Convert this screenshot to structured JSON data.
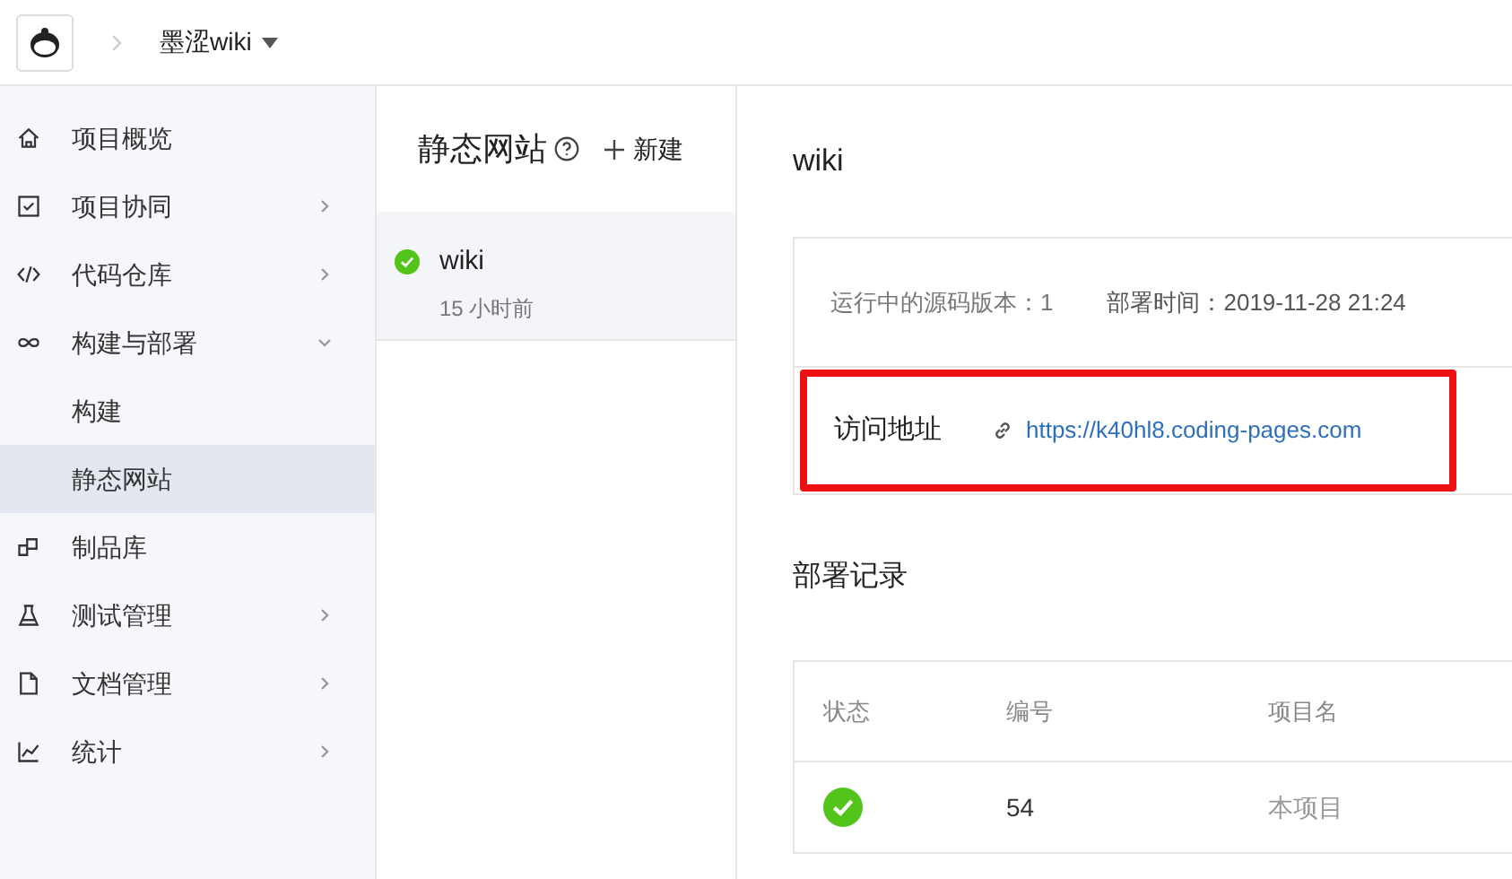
{
  "header": {
    "project": "墨涩wiki"
  },
  "sidebar": {
    "items": [
      {
        "label": "项目概览",
        "has_children": false,
        "selected": false
      },
      {
        "label": "项目协同",
        "has_children": true,
        "expanded": false,
        "selected": false
      },
      {
        "label": "代码仓库",
        "has_children": true,
        "expanded": false,
        "selected": false
      },
      {
        "label": "构建与部署",
        "has_children": true,
        "expanded": true,
        "selected": false,
        "children": [
          {
            "label": "构建",
            "selected": false
          },
          {
            "label": "静态网站",
            "selected": true
          }
        ]
      },
      {
        "label": "制品库",
        "has_children": false,
        "selected": false
      },
      {
        "label": "测试管理",
        "has_children": true,
        "expanded": false,
        "selected": false
      },
      {
        "label": "文档管理",
        "has_children": true,
        "expanded": false,
        "selected": false
      },
      {
        "label": "统计",
        "has_children": true,
        "expanded": false,
        "selected": false
      }
    ]
  },
  "site_list": {
    "title": "静态网站",
    "new_label": "新建",
    "items": [
      {
        "name": "wiki",
        "time": "15 小时前",
        "selected": true
      }
    ]
  },
  "detail": {
    "title": "wiki",
    "version": "运行中的源码版本：1",
    "deploy_time": "部署时间：2019-11-28 21:24",
    "url_label": "访问地址",
    "url": "https://k40hl8.coding-pages.com",
    "highlighted": true
  },
  "records": {
    "title": "部署记录",
    "columns": [
      "状态",
      "编号",
      "项目名"
    ],
    "rows": [
      {
        "number": "54",
        "project": "本项目"
      }
    ]
  }
}
